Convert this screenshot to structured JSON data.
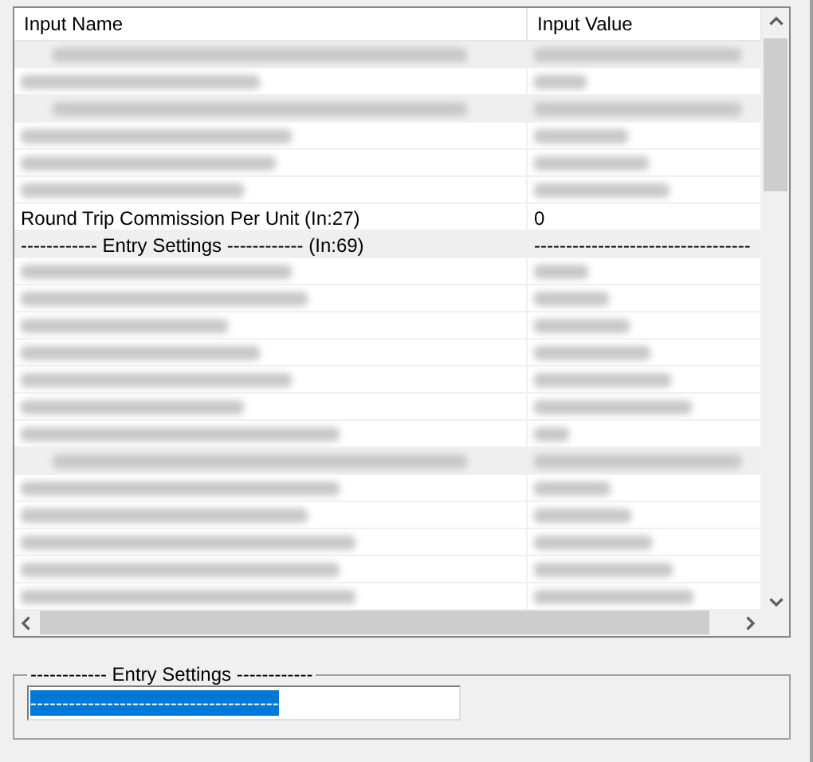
{
  "table": {
    "columns": [
      "Input Name",
      "Input Value"
    ],
    "rows": [
      {
        "kind": "blurred",
        "section": true
      },
      {
        "kind": "blurred",
        "section": false
      },
      {
        "kind": "blurred",
        "section": true
      },
      {
        "kind": "blurred",
        "section": false
      },
      {
        "kind": "blurred",
        "section": false
      },
      {
        "kind": "blurred",
        "section": false
      },
      {
        "kind": "text",
        "section": false,
        "name": "Round Trip Commission Per Unit  (In:27)",
        "value": "0"
      },
      {
        "kind": "text",
        "section": true,
        "name": "------------ Entry Settings ------------   (In:69)",
        "value": "----------------------------------"
      },
      {
        "kind": "blurred",
        "section": false
      },
      {
        "kind": "blurred",
        "section": false
      },
      {
        "kind": "blurred",
        "section": false
      },
      {
        "kind": "blurred",
        "section": false
      },
      {
        "kind": "blurred",
        "section": false
      },
      {
        "kind": "blurred",
        "section": false
      },
      {
        "kind": "blurred",
        "section": false
      },
      {
        "kind": "blurred",
        "section": true
      },
      {
        "kind": "blurred",
        "section": false
      },
      {
        "kind": "blurred",
        "section": false
      },
      {
        "kind": "blurred",
        "section": false
      },
      {
        "kind": "blurred",
        "section": false
      },
      {
        "kind": "blurred",
        "section": false
      }
    ]
  },
  "group_box": {
    "title": "------------ Entry Settings ------------",
    "field_value": "---------------------------------------"
  }
}
